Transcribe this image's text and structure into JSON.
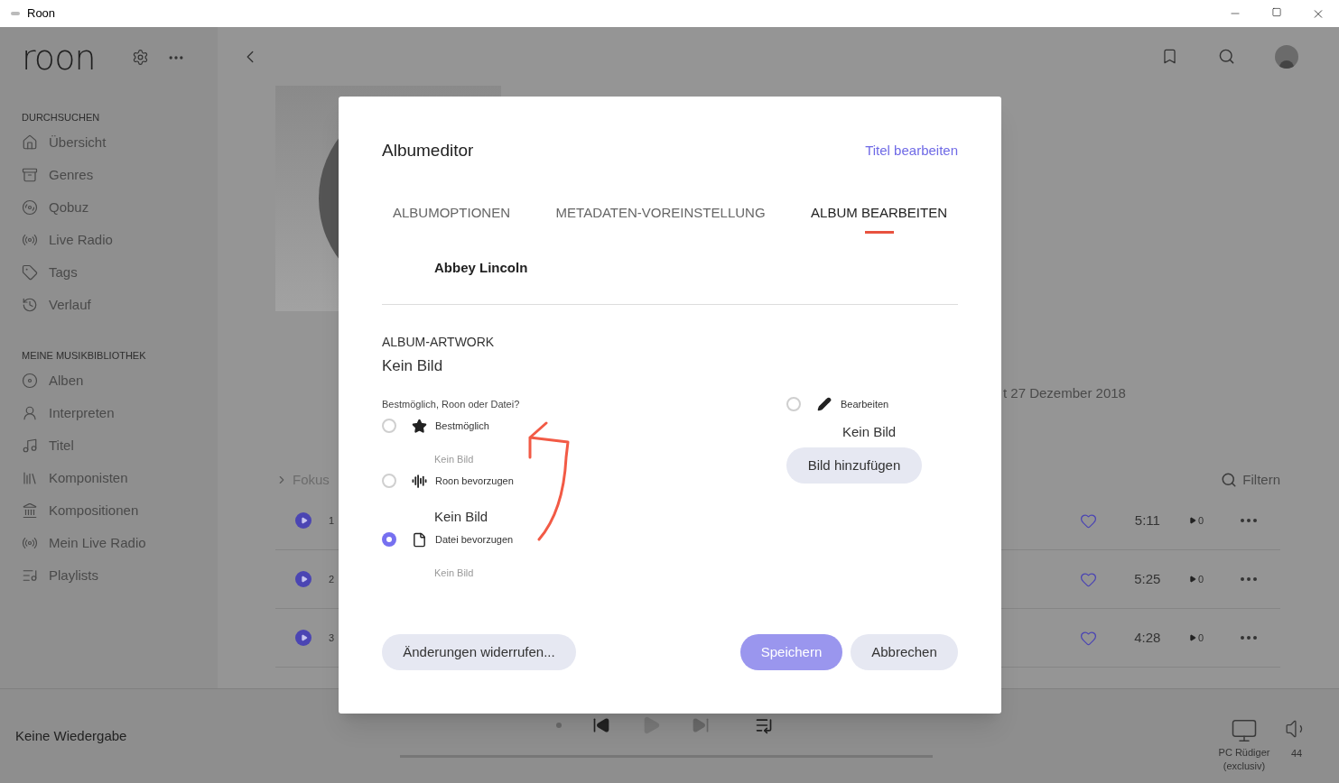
{
  "window": {
    "title": "Roon"
  },
  "sidebar": {
    "logo": "roon",
    "sections": [
      {
        "heading": "DURCHSUCHEN",
        "items": [
          {
            "label": "Übersicht"
          },
          {
            "label": "Genres"
          },
          {
            "label": "Qobuz"
          },
          {
            "label": "Live Radio"
          },
          {
            "label": "Tags"
          },
          {
            "label": "Verlauf"
          }
        ]
      },
      {
        "heading": "MEINE MUSIKBIBLIOTHEK",
        "items": [
          {
            "label": "Alben"
          },
          {
            "label": "Interpreten"
          },
          {
            "label": "Titel"
          },
          {
            "label": "Komponisten"
          },
          {
            "label": "Kompositionen"
          },
          {
            "label": "Mein Live Radio"
          },
          {
            "label": "Playlists"
          }
        ]
      }
    ]
  },
  "album": {
    "date_text": "t 27 Dezember 2018",
    "focus": "Fokus",
    "filter": "Filtern",
    "tracks": [
      {
        "number": "1",
        "duration": "5:11",
        "plays": "0"
      },
      {
        "number": "2",
        "duration": "5:25",
        "plays": "0"
      },
      {
        "number": "3",
        "duration": "4:28",
        "plays": "0"
      }
    ]
  },
  "dialog": {
    "title": "Albumeditor",
    "link": "Titel bearbeiten",
    "tabs": [
      {
        "label": "ALBUMOPTIONEN",
        "selected": false
      },
      {
        "label": "METADATEN-VOREINSTELLUNG",
        "selected": false
      },
      {
        "label": "ALBUM BEARBEITEN",
        "selected": true
      }
    ],
    "artist": "Abbey Lincoln",
    "section": "ALBUM-ARTWORK",
    "current": "Kein Bild",
    "question": "Bestmöglich, Roon oder Datei?",
    "options": [
      {
        "label": "Bestmöglich",
        "selected": false,
        "preview": {
          "text": "Kein Bild",
          "kind": "small"
        }
      },
      {
        "label": "Roon bevorzugen",
        "selected": false,
        "preview": {
          "text": "Kein Bild",
          "kind": "large"
        }
      },
      {
        "label": "Datei bevorzugen",
        "selected": true,
        "preview": {
          "text": "Kein Bild",
          "kind": "small"
        }
      }
    ],
    "edit_option": {
      "label": "Bearbeiten",
      "selected": false,
      "preview": "Kein Bild",
      "button": "Bild hinzufügen"
    },
    "revert": "Änderungen widerrufen...",
    "save": {
      "label": "Speichern",
      "disabled": true
    },
    "cancel": "Abbrechen"
  },
  "player": {
    "status": "Keine Wiedergabe",
    "zone": "PC Rüdiger",
    "zone_mode": "(exclusiv)",
    "volume": "44"
  }
}
